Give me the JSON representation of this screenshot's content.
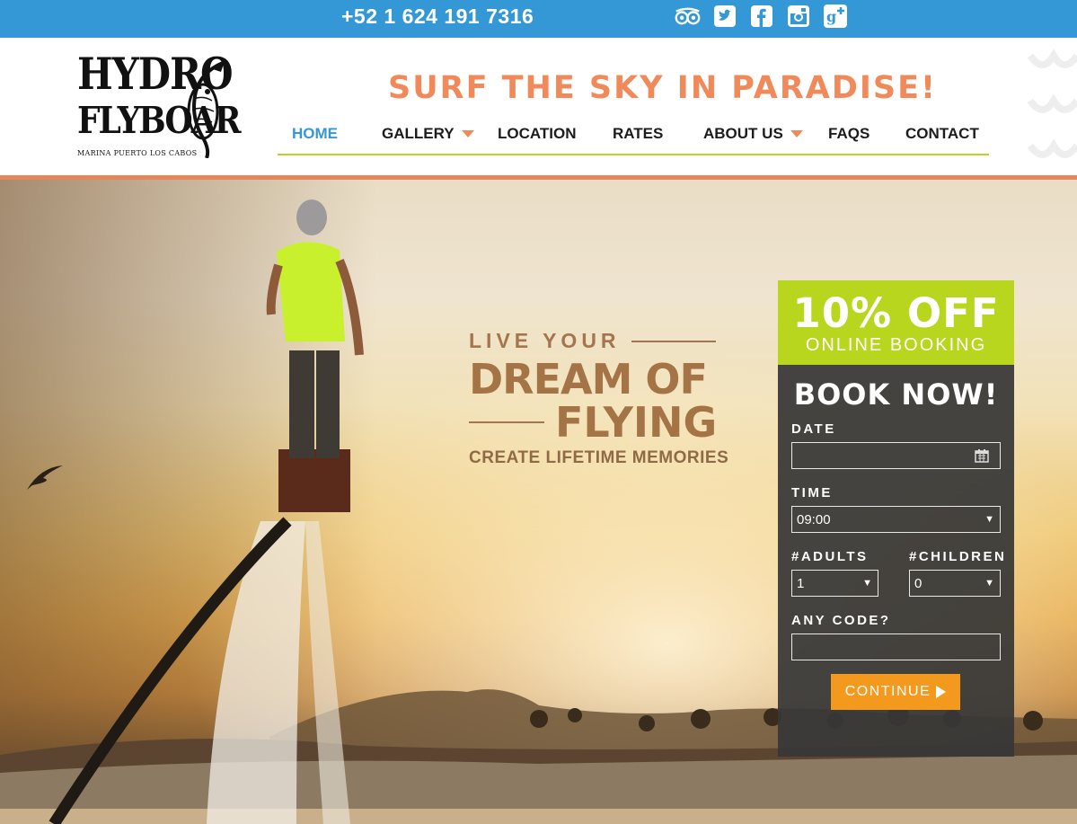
{
  "topbar": {
    "phone": "+52 1 624 191 7316",
    "social_icons": [
      "tripadvisor-icon",
      "twitter-icon",
      "facebook-icon",
      "instagram-icon",
      "google-plus-icon"
    ]
  },
  "header": {
    "logo": {
      "line1": "HYDRO",
      "line2": "FLYBOAR",
      "subtitle": "MARINA PUERTO LOS CABOS"
    },
    "tagline": "SURF THE SKY IN PARADISE!",
    "nav": [
      {
        "label": "HOME",
        "active": true,
        "has_dropdown": false
      },
      {
        "label": "GALLERY",
        "active": false,
        "has_dropdown": true
      },
      {
        "label": "LOCATION",
        "active": false,
        "has_dropdown": false
      },
      {
        "label": "RATES",
        "active": false,
        "has_dropdown": false
      },
      {
        "label": "ABOUT US",
        "active": false,
        "has_dropdown": true
      },
      {
        "label": "FAQS",
        "active": false,
        "has_dropdown": false
      },
      {
        "label": "CONTACT",
        "active": false,
        "has_dropdown": false
      }
    ]
  },
  "hero": {
    "line1": "LIVE YOUR",
    "line2": "DREAM OF",
    "line3": "FLYING",
    "line4": "CREATE LIFETIME MEMORIES"
  },
  "booking": {
    "promo_title": "10% OFF",
    "promo_subtitle": "ONLINE BOOKING",
    "title": "BOOK NOW!",
    "date_label": "DATE",
    "date_value": "",
    "time_label": "TIME",
    "time_value": "09:00",
    "adults_label": "#ADULTS",
    "adults_value": "1",
    "children_label": "#CHILDREN",
    "children_value": "0",
    "code_label": "ANY CODE?",
    "code_value": "",
    "continue_label": "CONTINUE"
  },
  "colors": {
    "topbar": "#3498d6",
    "accent_orange": "#f08a5a",
    "accent_green": "#b8d61e",
    "button_orange": "#f39a1e"
  }
}
